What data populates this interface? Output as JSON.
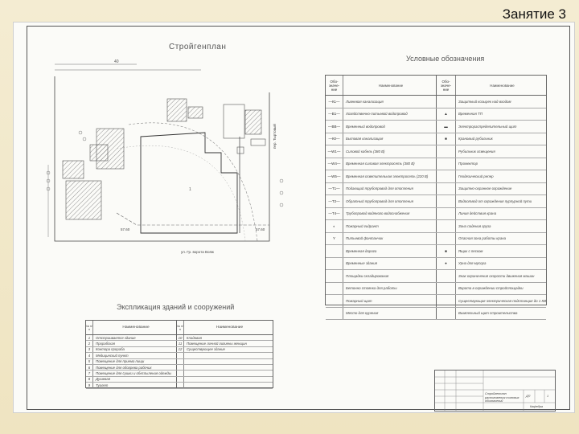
{
  "slide": {
    "title": "Занятие 3"
  },
  "plan": {
    "title": "Стройгенплан",
    "street_bottom": "ул. Гр. ворота Вояж",
    "street_right": "пер. Тыртовый",
    "level_a": "57.60",
    "level_b": "57.60",
    "dimension": "40",
    "main_building_no": "1"
  },
  "legend": {
    "title": "Условные обозначения",
    "head_sym": "Обо-\nзначе-\nние",
    "head_name": "Наименование",
    "rows": [
      {
        "s1": "—К1—",
        "n1": "Ливневая канализация",
        "s2": "",
        "n2": "Защитный козырек над входом"
      },
      {
        "s1": "—В1—",
        "n1": "Хозяйственно-питьевой водопровод",
        "s2": "▲",
        "n2": "Временная ТП"
      },
      {
        "s1": "—ВВ—",
        "n1": "Временный водопровод",
        "s2": "▬",
        "n2": "Электрораспределительный щит"
      },
      {
        "s1": "—К0—",
        "n1": "Бытовая канализация",
        "s2": "■",
        "n2": "Крановый рубильник"
      },
      {
        "s1": "—W1—",
        "n1": "Силовой кабель (380 В)",
        "s2": "",
        "n2": "Рубильник освещения"
      },
      {
        "s1": "—W4—",
        "n1": "Временная силовая электросеть (380 В)",
        "s2": "",
        "n2": "Прожектор"
      },
      {
        "s1": "—W5—",
        "n1": "Временная осветительная электросеть (220 В)",
        "s2": "",
        "n2": "Геодезический репер"
      },
      {
        "s1": "—Т1—",
        "n1": "Подающий трубопровод для отопления",
        "s2": "",
        "n2": "Защитно-охранное ограждение"
      },
      {
        "s1": "—Т2—",
        "n1": "Обратный трубопровод для отопления",
        "s2": "",
        "n2": "Водоотвод от ограждения пурпурной пути"
      },
      {
        "s1": "—Т4—",
        "n1": "Трубопровод водяного водоснабжения",
        "s2": "",
        "n2": "Линия действия крана"
      },
      {
        "s1": "◐",
        "n1": "Пожарный гидрант",
        "s2": "",
        "n2": "Зона падения груза"
      },
      {
        "s1": "Y",
        "n1": "Питьевой фонтанчик",
        "s2": "",
        "n2": "Опасная зона работы крана"
      },
      {
        "s1": "",
        "n1": "Временная дорога",
        "s2": "■",
        "n2": "Ящик с песком"
      },
      {
        "s1": "",
        "n1": "Временные здания",
        "s2": "●",
        "n2": "Урна для мусора"
      },
      {
        "s1": "",
        "n1": "Площадки складирования",
        "s2": "",
        "n2": "Знак ограничения скорости движения машин"
      },
      {
        "s1": "",
        "n1": "Бетонно стоянка для работы",
        "s2": "",
        "n2": "Ворота в ограждении стройплощадки"
      },
      {
        "s1": "",
        "n1": "Пожарный щит",
        "s2": "",
        "n2": "Существующая электрическая подстанция до 1 КВт"
      },
      {
        "s1": "",
        "n1": "Место для курения",
        "s2": "",
        "n2": "Вымпельный щит строительства"
      }
    ]
  },
  "explication": {
    "title": "Экспликация зданий и сооружений",
    "head_no": "№ п/п",
    "head_name": "Наименование",
    "rows": [
      {
        "n1": "1",
        "t1": "Отстраивается здание",
        "n2": "10",
        "t2": "Кладовая"
      },
      {
        "n1": "2",
        "t1": "Прорабская",
        "n2": "11",
        "t2": "Помещение личной гигиены женщин"
      },
      {
        "n1": "3",
        "t1": "Контора прораба",
        "n2": "12",
        "t2": "Существующее здание"
      },
      {
        "n1": "4",
        "t1": "Медицинский пункт",
        "n2": "",
        "t2": ""
      },
      {
        "n1": "5",
        "t1": "Помещение для приема пищи",
        "n2": "",
        "t2": ""
      },
      {
        "n1": "6",
        "t1": "Помещение для обогрева рабочих",
        "n2": "",
        "t2": ""
      },
      {
        "n1": "7",
        "t1": "Помещение для сушки и обеспыления одежды",
        "n2": "",
        "t2": ""
      },
      {
        "n1": "8",
        "t1": "Душевая",
        "n2": "",
        "t2": ""
      },
      {
        "n1": "9",
        "t1": "Туалет",
        "n2": "",
        "t2": ""
      }
    ]
  },
  "stamp": {
    "sheet": "ДП",
    "sheet_no": "1",
    "desc": "Стройгенплан расположения типовых обозначений",
    "org": "Кафедра"
  }
}
